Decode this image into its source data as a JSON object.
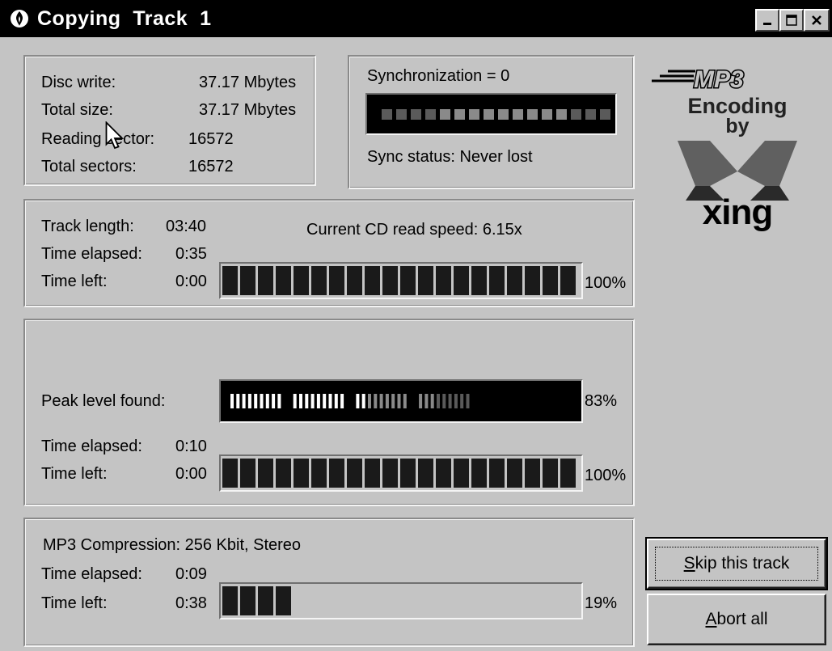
{
  "window": {
    "title": "Copying  Track  1",
    "title_icon": "xing-flame-icon",
    "minimize_icon": "minimize-icon",
    "maximize_icon": "maximize-icon",
    "close_icon": "close-icon"
  },
  "disc": {
    "disc_write_label": "Disc write:",
    "disc_write_value": "37.17 Mbytes",
    "total_size_label": "Total size:",
    "total_size_value": "37.17 Mbytes",
    "reading_sector_label": "Reading sector:",
    "reading_sector_value": "16572",
    "total_sectors_label": "Total sectors:",
    "total_sectors_value": "16572"
  },
  "sync": {
    "label": "Synchronization = 0",
    "status": "Sync status: Never lost",
    "meter_lit_from": 4,
    "meter_segments": 16
  },
  "track": {
    "length_label": "Track length:",
    "length_value": "03:40",
    "elapsed_label": "Time elapsed:",
    "elapsed_value": "0:35",
    "left_label": "Time left:",
    "left_value": "0:00",
    "read_speed": "Current CD read speed: 6.15x",
    "progress": 1.0,
    "percent": "100%"
  },
  "peak": {
    "label": "Peak level found:",
    "level": 0.83,
    "level_percent": "83%",
    "elapsed_label": "Time elapsed:",
    "elapsed_value": "0:10",
    "left_label": "Time left:",
    "left_value": "0:00",
    "progress": 1.0,
    "percent": "100%"
  },
  "compression": {
    "label": "MP3 Compression: 256 Kbit, Stereo",
    "elapsed_label": "Time elapsed:",
    "elapsed_value": "0:09",
    "left_label": "Time left:",
    "left_value": "0:38",
    "progress": 0.19,
    "percent": "19%"
  },
  "buttons": {
    "skip_label": "Skip this track",
    "skip_accel": "S",
    "skip_rest": "kip this track",
    "abort_label": "Abort all",
    "abort_accel": "A",
    "abort_rest": "bort all"
  },
  "logo": {
    "mp3": "MP3",
    "line1": "Encoding",
    "line2": "by",
    "brand": "xing"
  },
  "colors": {
    "face": "#c4c4c4",
    "segment": "#1a1a1a",
    "meter_dim": "#5a5a5a",
    "meter_mid": "#8a8a8a",
    "meter_bright": "#ffffff"
  }
}
